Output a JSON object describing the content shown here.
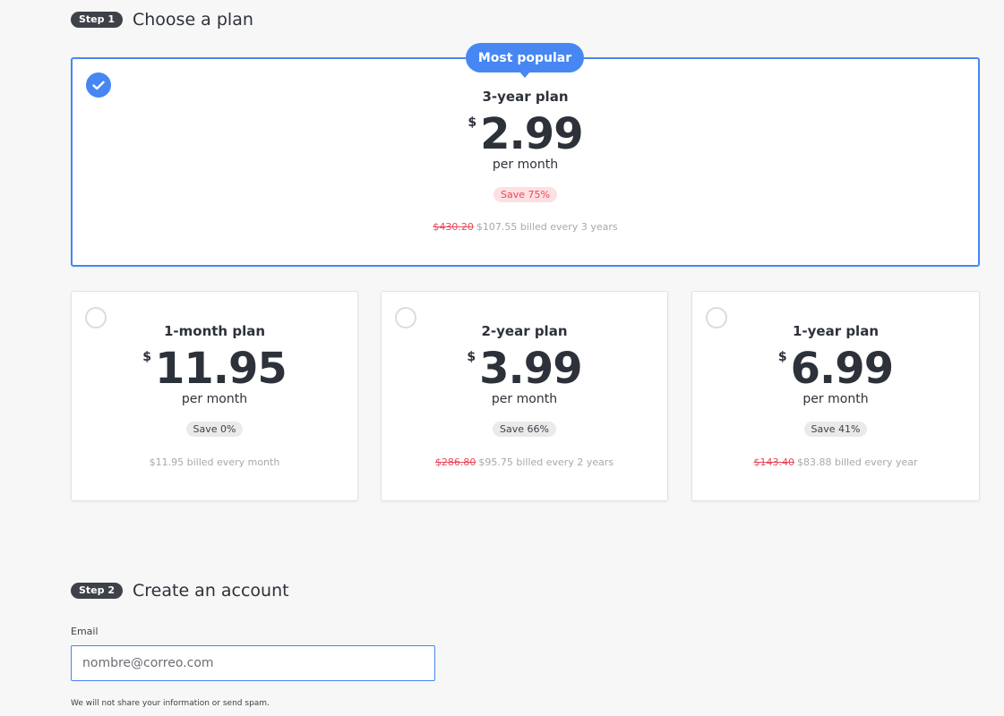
{
  "step1": {
    "badge": "Step 1",
    "title": "Choose a plan"
  },
  "featured_plan": {
    "badge": "Most popular",
    "name": "3-year plan",
    "currency": "$",
    "price": "2.99",
    "period": "per month",
    "save": "Save 75%",
    "old_price": "$430.20",
    "billing": "$107.55 billed every 3 years",
    "selected": true
  },
  "plans": [
    {
      "name": "1-month plan",
      "currency": "$",
      "price": "11.95",
      "period": "per month",
      "save": "Save 0%",
      "old_price": "",
      "billing": "$11.95 billed every month"
    },
    {
      "name": "2-year plan",
      "currency": "$",
      "price": "3.99",
      "period": "per month",
      "save": "Save 66%",
      "old_price": "$286.80",
      "billing": "$95.75 billed every 2 years"
    },
    {
      "name": "1-year plan",
      "currency": "$",
      "price": "6.99",
      "period": "per month",
      "save": "Save 41%",
      "old_price": "$143.40",
      "billing": "$83.88 billed every year"
    }
  ],
  "step2": {
    "badge": "Step 2",
    "title": "Create an account"
  },
  "email": {
    "label": "Email",
    "value": "nombre@correo.com"
  },
  "privacy_note": "We will not share your information or send spam.",
  "colors": {
    "accent": "#4687f4",
    "discount": "#e8495c",
    "badge_dark": "#3e4248"
  }
}
